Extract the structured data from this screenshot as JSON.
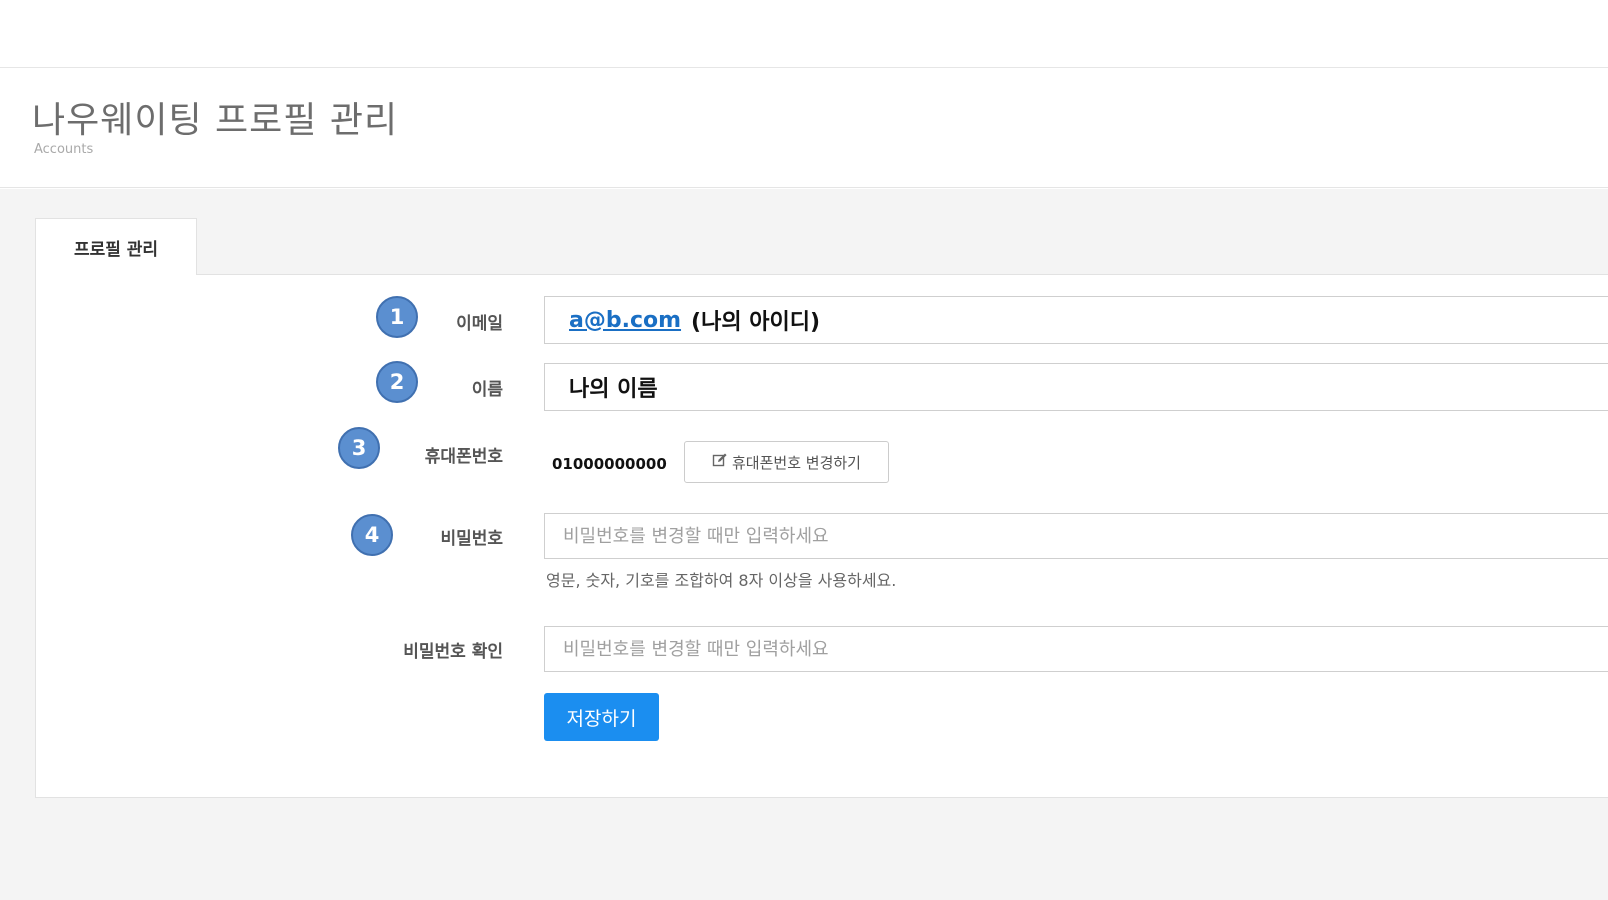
{
  "header": {
    "title": "나우웨이팅 프로필 관리",
    "subtitle": "Accounts"
  },
  "tab": {
    "label": "프로필 관리"
  },
  "form": {
    "email": {
      "badge": "1",
      "label": "이메일",
      "link": "a@b.com",
      "suffix": "(나의 아이디)"
    },
    "name": {
      "badge": "2",
      "label": "이름",
      "value": "나의 이름"
    },
    "phone": {
      "badge": "3",
      "label": "휴대폰번호",
      "value": "01000000000",
      "change_button": "휴대폰번호 변경하기"
    },
    "password": {
      "badge": "4",
      "label": "비밀번호",
      "placeholder": "비밀번호를 변경할 때만 입력하세요",
      "help": "영문, 숫자, 기호를 조합하여 8자 이상을 사용하세요."
    },
    "password_confirm": {
      "label": "비밀번호 확인",
      "placeholder": "비밀번호를 변경할 때만 입력하세요"
    },
    "save_button": "저장하기"
  },
  "colors": {
    "accent": "#1b8ef0",
    "badge": "#5b8fd0",
    "link": "#1a6fc4"
  },
  "icons": {
    "edit": "edit-icon"
  }
}
